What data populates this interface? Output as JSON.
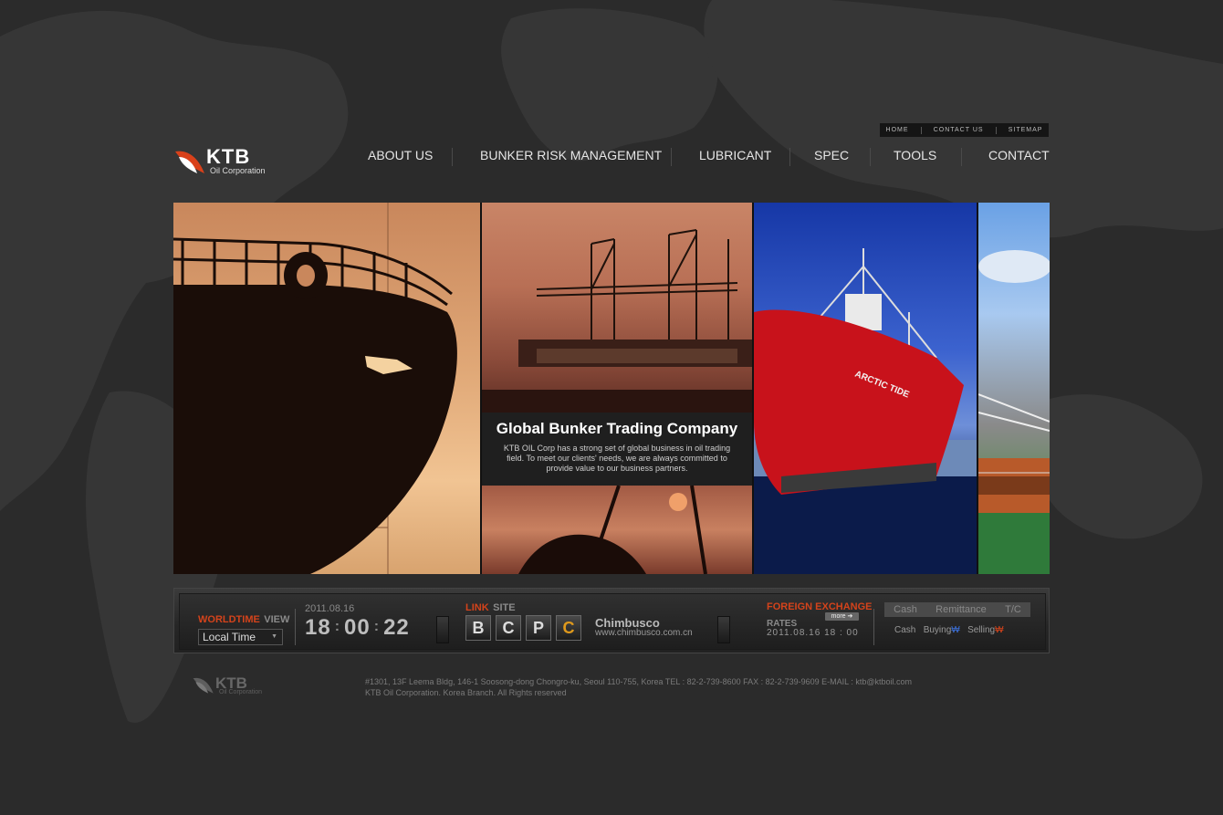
{
  "util_nav": [
    "HOME",
    "CONTACT US",
    "SITEMAP"
  ],
  "logo": {
    "name": "KTB",
    "sub": "Oil Corporation"
  },
  "nav": [
    "ABOUT US",
    "BUNKER RISK MANAGEMENT",
    "LUBRICANT",
    "SPEC",
    "TOOLS",
    "CONTACT"
  ],
  "hero": {
    "title": "Global Bunker Trading Company",
    "description": "KTB OIL Corp has a strong set of global business in oil trading field. To meet our clients' needs, we are always committed to provide value to our business partners.",
    "ship_name": "ARCTIC TIDE"
  },
  "worldtime": {
    "label_red": "WORLDTIME",
    "label_grey": "VIEW",
    "select_value": "Local Time",
    "date": "2011.08.16",
    "hh": "18",
    "mm": "00",
    "ss": "22"
  },
  "link_site": {
    "label_red": "LINK",
    "label_grey": "SITE",
    "buttons": [
      "B",
      "C",
      "P",
      "C"
    ],
    "site_name": "Chimbusco",
    "site_url": "www.chimbusco.com.cn"
  },
  "forex": {
    "label_red": "FOREIGN EXCHANGE",
    "label_grey": "RATES",
    "more": "more",
    "date": "2011.08.16 18 : 00",
    "tabs": [
      "Cash",
      "Remittance",
      "T/C"
    ],
    "row": {
      "cash": "Cash",
      "buying": "Buying",
      "selling": "Selling",
      "won": "₩"
    }
  },
  "footer": {
    "address": "#1301, 13F Leema Bldg, 146-1 Soosong-dong Chongro-ku, Seoul 110-755, Korea TEL :  82-2-739-8600  FAX : 82-2-739-9609  E-MAIL : ktb@ktboil.com",
    "copyright": "KTB Oil  Corporation. Korea Branch. All Rights reserved",
    "logo_name": "KTB",
    "logo_sub": "Oil Corporation"
  }
}
